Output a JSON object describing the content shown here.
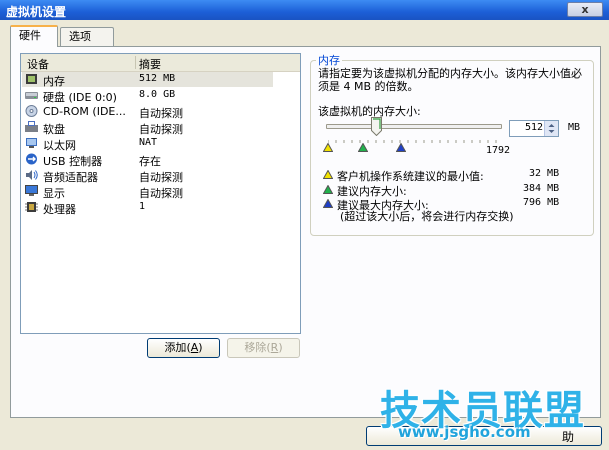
{
  "window": {
    "title": "虚拟机设置",
    "close_label": "x"
  },
  "tabs": [
    {
      "label": "硬件"
    },
    {
      "label": "选项"
    }
  ],
  "device_list": {
    "headers": {
      "device": "设备",
      "summary": "摘要"
    },
    "rows": [
      {
        "name": "内存",
        "summary": "512 MB",
        "icon": "memory-icon"
      },
      {
        "name": "硬盘 (IDE 0:0)",
        "summary": "8.0 GB",
        "icon": "hard-disk-icon"
      },
      {
        "name": "CD-ROM (IDE...",
        "summary": "自动探测",
        "icon": "cdrom-icon"
      },
      {
        "name": "软盘",
        "summary": "自动探测",
        "icon": "floppy-icon"
      },
      {
        "name": "以太网",
        "summary": "NAT",
        "icon": "network-icon"
      },
      {
        "name": "USB 控制器",
        "summary": "存在",
        "icon": "usb-icon"
      },
      {
        "name": "音频适配器",
        "summary": "自动探测",
        "icon": "sound-icon"
      },
      {
        "name": "显示",
        "summary": "自动探测",
        "icon": "display-icon"
      },
      {
        "name": "处理器",
        "summary": "1",
        "icon": "cpu-icon"
      }
    ]
  },
  "buttons": {
    "add_text": "添加",
    "add_key": "A",
    "remove_text": "移除",
    "remove_key": "R"
  },
  "memory": {
    "group_title": "内存",
    "description": "请指定要为该虚拟机分配的内存大小。该内存大小值必须是 4 MB 的倍数。",
    "size_label": "该虚拟机的内存大小:",
    "value": "512",
    "unit": "MB",
    "slider_max_label": "1792",
    "slider_value": 512,
    "slider_max": 1792,
    "legend": [
      {
        "label": "客户机操作系统建议的最小值:",
        "value": "32 MB",
        "color": "#f2e200"
      },
      {
        "label": "建议内存大小:",
        "value": "384 MB",
        "color": "#22b14c"
      },
      {
        "label": "建议最大内存大小:",
        "value": "796 MB",
        "color": "#1f3fc6"
      }
    ],
    "note": "(超过该大小后，将会进行内存交换)"
  },
  "bottom_button_text": "助",
  "watermark": {
    "text": "技术员联盟",
    "url": "www.jsgho.com"
  }
}
